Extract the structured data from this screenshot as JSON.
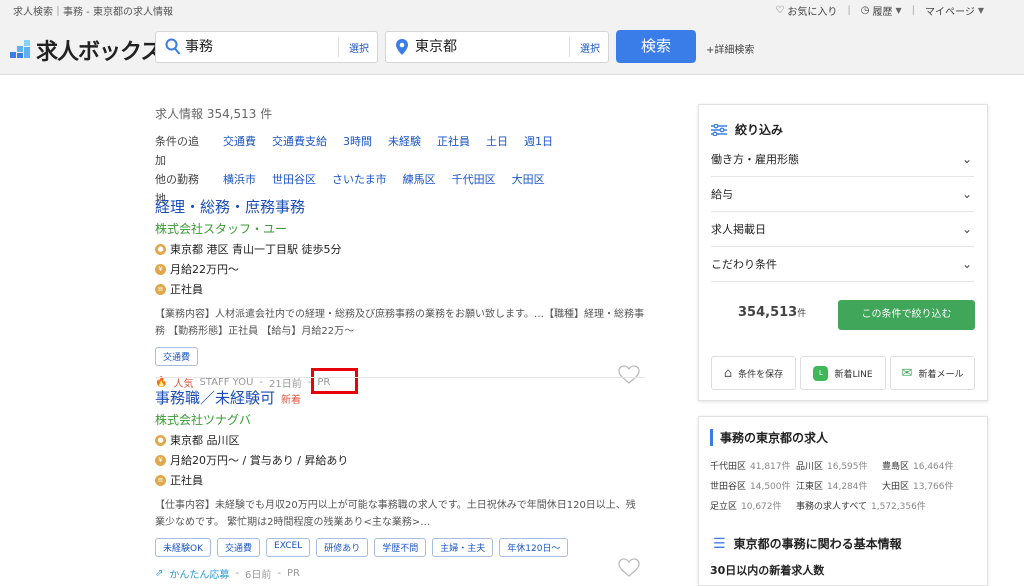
{
  "header": {
    "breadcrumb": "求人検索｜事務 - 東京都の求人情報",
    "favorites": "お気に入り",
    "history": "履歴",
    "mypage": "マイページ",
    "logo": "求人ボックス",
    "keyword": "事務",
    "location": "東京都",
    "select_label": "選択",
    "search_button": "検索",
    "advanced": "+詳細検索"
  },
  "main": {
    "count": "求人情報 354,513 件",
    "filter_add_label": "条件の追加",
    "filter_add": [
      "交通費",
      "交通費支給",
      "3時間",
      "未経験",
      "正社員",
      "土日",
      "週1日"
    ],
    "filter_area_label": "他の勤務地",
    "filter_area": [
      "横浜市",
      "世田谷区",
      "さいたま市",
      "練馬区",
      "千代田区",
      "大田区"
    ],
    "jobs": [
      {
        "title": "経理・総務・庶務事務",
        "new": "",
        "company": "株式会社スタッフ・ユー",
        "location": "東京都 港区 青山一丁目駅 徒歩5分",
        "salary": "月給22万円～",
        "employment": "正社員",
        "desc": "【業務内容】人材派遣会社内での経理・総務及び庶務事務の業務をお願い致します。…【職種】経理・総務事務 【勤務形態】正社員 【給与】月給22万～",
        "tags": [
          "交通費"
        ],
        "badge": "人気",
        "source": "STAFF YOU",
        "date": "21日前",
        "pr": "PR"
      },
      {
        "title": "事務職／未経験可",
        "new": "新着",
        "company": "株式会社ツナグバ",
        "location": "東京都 品川区",
        "salary": "月給20万円～ / 賞与あり / 昇給あり",
        "employment": "正社員",
        "desc": "【仕事内容】未経験でも月収20万円以上が可能な事務職の求人です。土日祝休みで年間休日120日以上、残業少なめです。 繁忙期は2時間程度の残業あり<主な業務>…",
        "tags": [
          "未経験OK",
          "交通費",
          "EXCEL",
          "研修あり",
          "学歴不問",
          "主婦・主夫",
          "年休120日～"
        ],
        "badge": "かんたん応募",
        "source": "",
        "date": "6日前",
        "pr": "PR"
      }
    ]
  },
  "side": {
    "title": "絞り込み",
    "accordions": [
      "働き方・雇用形態",
      "給与",
      "求人掲載日",
      "こだわり条件"
    ],
    "total": "354,513",
    "total_unit": "件",
    "apply": "この条件で絞り込む",
    "save": "条件を保存",
    "line": "新着LINE",
    "mail": "新着メール"
  },
  "side2": {
    "title": "事務の東京都の求人",
    "wards": [
      {
        "name": "千代田区",
        "count": "41,817件"
      },
      {
        "name": "品川区",
        "count": "16,595件"
      },
      {
        "name": "豊島区",
        "count": "16,464件"
      },
      {
        "name": "世田谷区",
        "count": "14,500件"
      },
      {
        "name": "江東区",
        "count": "14,284件"
      },
      {
        "name": "大田区",
        "count": "13,766件"
      },
      {
        "name": "足立区",
        "count": "10,672件"
      },
      {
        "name": "事務の求人すべて",
        "count": "1,572,356件"
      }
    ],
    "basic_info": "東京都の事務に関わる基本情報",
    "recent": "30日以内の新着求人数"
  },
  "colors": {
    "accent": "#3a7de8",
    "green": "#3fa65a",
    "pr_highlight": "#e8000b"
  }
}
